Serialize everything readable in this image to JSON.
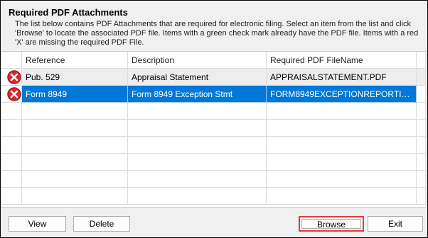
{
  "dialog": {
    "title": "Required PDF Attachments",
    "description": "The list below contains PDF Attachments that are required for electronic filing. Select an item from the list and click 'Browse' to locate the associated PDF file. Items with a green check mark already have the PDF file. Items with a red 'X' are missing the required PDF File."
  },
  "grid": {
    "columns": [
      "Reference",
      "Description",
      "Required PDF FileName"
    ],
    "rows": [
      {
        "status_icon": "red-x-icon",
        "reference": "Pub. 529",
        "description": "Appraisal Statement",
        "filename": "APPRAISALSTATEMENT.PDF",
        "selected": false
      },
      {
        "status_icon": "red-x-icon",
        "reference": "Form 8949",
        "description": "Form 8949 Exception Stmt",
        "filename": "FORM8949EXCEPTIONREPORTINGS...",
        "selected": true
      }
    ]
  },
  "buttons": {
    "view": "View",
    "delete": "Delete",
    "browse": "Browse",
    "exit": "Exit"
  },
  "colors": {
    "selection": "#0078d7",
    "error_icon": "#d9262b",
    "highlight_box": "#e0393b"
  }
}
